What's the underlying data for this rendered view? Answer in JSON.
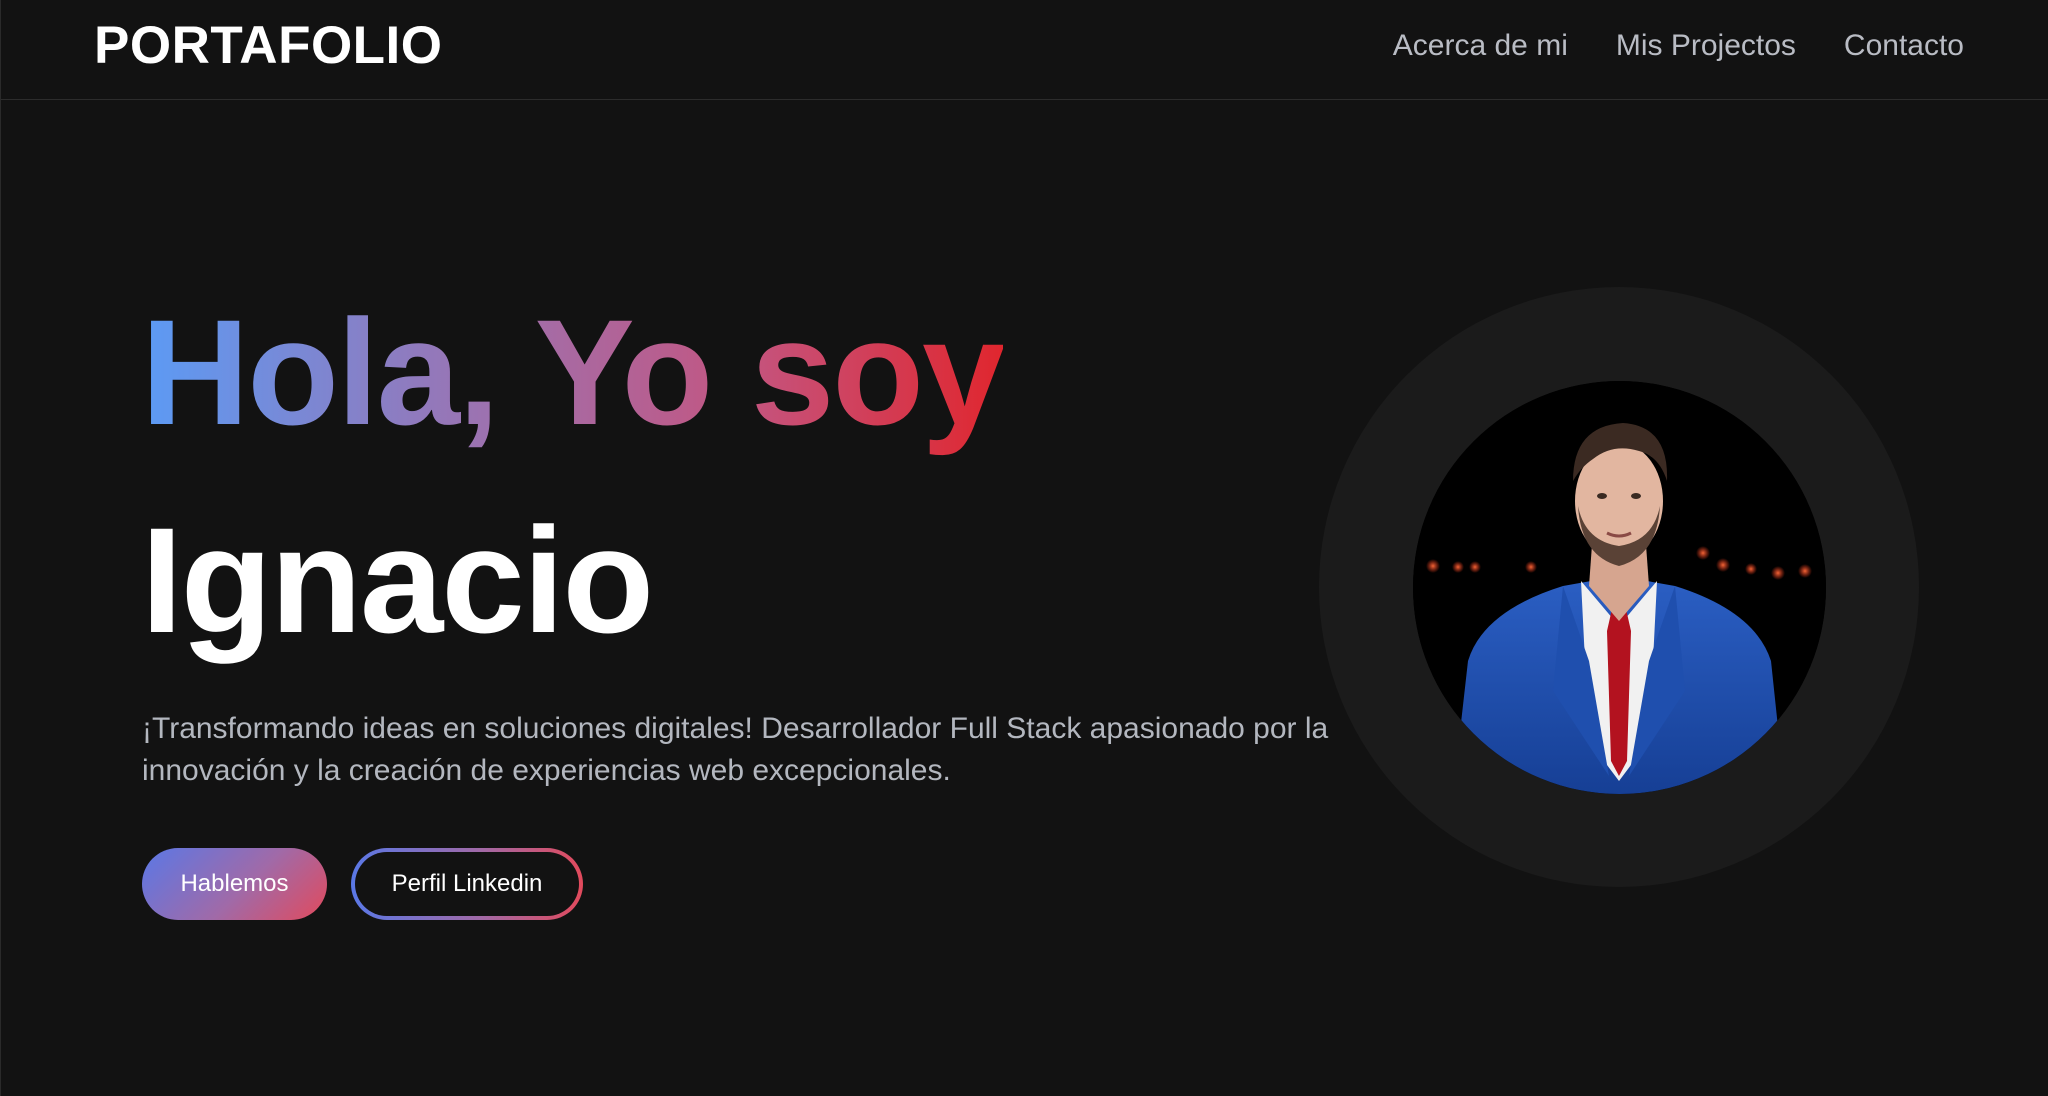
{
  "brand": "PORTAFOLIO",
  "nav": {
    "items": [
      {
        "label": "Acerca de mi"
      },
      {
        "label": "Mis Projectos"
      },
      {
        "label": "Contacto"
      }
    ]
  },
  "hero": {
    "greeting": "Hola, Yo soy",
    "name": "Ignacio",
    "description": "¡Transformando ideas en soluciones digitales! Desarrollador Full Stack apasionado por la innovación y la creación de experiencias web excepcionales.",
    "primary_button": "Hablemos",
    "secondary_button": "Perfil Linkedin"
  },
  "colors": {
    "background": "#121212",
    "gradient_start": "#5b9bf5",
    "gradient_end": "#e0262e",
    "nav_text": "#b9bcc4"
  }
}
